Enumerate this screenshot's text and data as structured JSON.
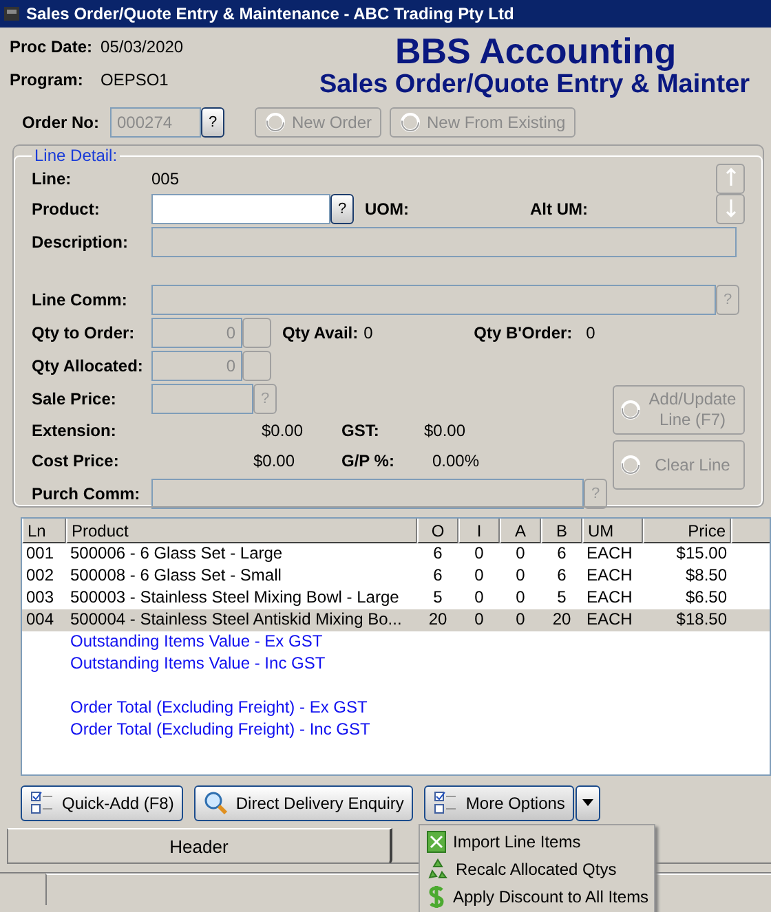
{
  "window": {
    "title": "Sales Order/Quote Entry & Maintenance - ABC Trading Pty Ltd"
  },
  "info": [
    {
      "label": "Proc Date:",
      "value": "05/03/2020"
    },
    {
      "label": "Program:",
      "value": "OEPSO1"
    }
  ],
  "brand": {
    "title": "BBS Accounting",
    "subtitle": "Sales Order/Quote Entry & Mainter"
  },
  "order": {
    "label": "Order No:",
    "value": "000274",
    "lookup": "?"
  },
  "order_buttons": [
    {
      "label": "New Order",
      "disabled": true
    },
    {
      "label": "New From Existing",
      "disabled": true
    }
  ],
  "line_detail": {
    "legend": "Line Detail:",
    "line_label": "Line:",
    "line_value": "005",
    "product_label": "Product:",
    "product_lookup": "?",
    "uom_label": "UOM:",
    "alt_um_label": "Alt UM:",
    "description_label": "Description:",
    "line_comm_label": "Line Comm:",
    "line_comm_lookup": "?",
    "qty_order_label": "Qty to Order:",
    "qty_order_value": "0",
    "qty_avail_label": "Qty Avail:",
    "qty_avail_value": "0",
    "qty_border_label": "Qty B'Order:",
    "qty_border_value": "0",
    "qty_alloc_label": "Qty Allocated:",
    "qty_alloc_value": "0",
    "sale_price_label": "Sale Price:",
    "sale_price_lookup": "?",
    "extension_label": "Extension:",
    "extension_value": "$0.00",
    "gst_label": "GST:",
    "gst_value": "$0.00",
    "cost_label": "Cost Price:",
    "cost_value": "$0.00",
    "gp_label": "G/P %:",
    "gp_value": "0.00%",
    "purch_comm_label": "Purch Comm:",
    "purch_comm_lookup": "?",
    "buttons": [
      {
        "label": "Add/Update Line (F7)",
        "disabled": true
      },
      {
        "label": "Clear Line",
        "disabled": true
      }
    ]
  },
  "table": {
    "columns": [
      "Ln",
      "Product",
      "O",
      "I",
      "A",
      "B",
      "UM",
      "Price"
    ],
    "rows": [
      {
        "cells": [
          "001",
          "500006 - 6 Glass Set - Large",
          "6",
          "0",
          "0",
          "6",
          "EACH",
          "$15.00"
        ],
        "selected": false
      },
      {
        "cells": [
          "002",
          "500008 - 6 Glass Set - Small",
          "6",
          "0",
          "0",
          "6",
          "EACH",
          "$8.50"
        ],
        "selected": false
      },
      {
        "cells": [
          "003",
          "500003 - Stainless Steel Mixing Bowl - Large",
          "5",
          "0",
          "0",
          "5",
          "EACH",
          "$6.50"
        ],
        "selected": false
      },
      {
        "cells": [
          "004",
          "500004 - Stainless Steel Antiskid Mixing Bo...",
          "20",
          "0",
          "0",
          "20",
          "EACH",
          "$18.50"
        ],
        "selected": true
      }
    ],
    "summary": [
      [
        "Outstanding Items Value - Ex GST",
        "Outstanding Items Value - Inc GST"
      ],
      [
        "Order Total (Excluding Freight) - Ex GST",
        "Order Total (Excluding Freight) - Inc GST"
      ]
    ]
  },
  "actions": [
    {
      "label": "Quick-Add (F8)",
      "kind": "checklist"
    },
    {
      "label": "Direct Delivery Enquiry",
      "kind": "search"
    },
    {
      "label": "More Options",
      "kind": "checklist",
      "dropdown": true
    }
  ],
  "menu": [
    {
      "label": "Import Line Items",
      "kind": "import"
    },
    {
      "label": "Recalc Allocated Qtys",
      "kind": "recycle"
    },
    {
      "label": "Apply Discount to All Items",
      "kind": "dollar"
    }
  ],
  "tabs": [
    {
      "label": "Header",
      "selected": true
    }
  ]
}
